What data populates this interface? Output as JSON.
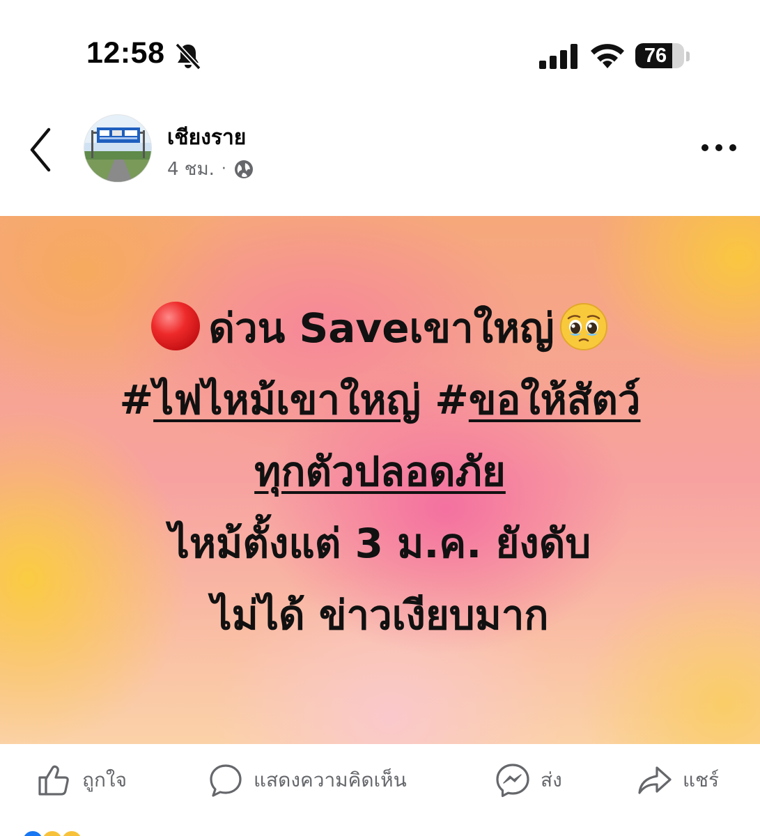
{
  "status_bar": {
    "time": "12:58",
    "silent_icon": "bell-slash-icon",
    "signal_icon": "cellular-signal-icon",
    "wifi_icon": "wifi-icon",
    "battery_level": "76",
    "battery_fraction": 0.76
  },
  "post": {
    "author": "เชียงราย",
    "time_ago": "4 ชม.",
    "separator": "·",
    "audience_icon": "globe-icon",
    "more_icon": "more-horizontal-icon",
    "back_icon": "chevron-left-icon",
    "line1_text": "ด่วน Saveเขาใหญ่",
    "line1_icon_left": "red-circle-icon",
    "line1_icon_right": "pleading-face-icon",
    "hash1": "#",
    "tag1": "ไฟไหม้เขาใหญ่",
    "hash2": " #",
    "tag2_part1": "ขอให้สัตว์",
    "tag2_part2": "ทุกตัวปลอดภัย",
    "line4": "ไหม้ตั้งแต่ 3 ม.ค. ยังดับ",
    "line5": "ไม่ได้ ข่าวเงียบมาก"
  },
  "actions": {
    "like": "ถูกใจ",
    "comment": "แสดงความคิดเห็น",
    "send": "ส่ง",
    "share": "แชร์"
  },
  "colors": {
    "text": "#050505",
    "secondary": "#65676b",
    "icon_gray": "#65676b"
  }
}
